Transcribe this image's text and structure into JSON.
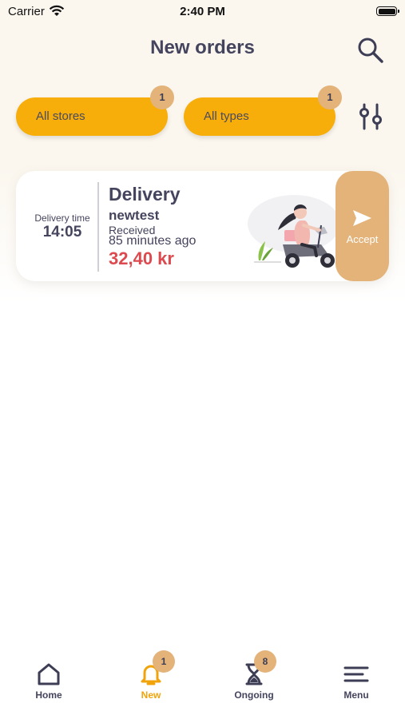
{
  "status_bar": {
    "carrier": "Carrier",
    "time": "2:40 PM"
  },
  "header": {
    "title": "New orders",
    "search_icon": "search-icon",
    "filter_icon": "sliders-icon"
  },
  "filters": [
    {
      "label": "All stores",
      "badge": "1"
    },
    {
      "label": "All types",
      "badge": "1"
    }
  ],
  "order": {
    "time_label": "Delivery time",
    "time": "14:05",
    "type": "Delivery",
    "customer": "newtest",
    "status": "Received",
    "elapsed": "85 minutes ago",
    "price": "32,40 kr",
    "accept_label": "Accept",
    "illustration": "scooter-rider-illustration"
  },
  "tabs": [
    {
      "label": "Home",
      "icon": "home-icon"
    },
    {
      "label": "New",
      "icon": "bell-icon",
      "badge": "1",
      "active": true
    },
    {
      "label": "Ongoing",
      "icon": "hourglass-icon",
      "badge": "8"
    },
    {
      "label": "Menu",
      "icon": "menu-icon"
    }
  ],
  "colors": {
    "accent": "#f7ae0a",
    "badge": "#e3b37a",
    "price": "#dc4a4f",
    "text": "#45445e",
    "active_tab": "#f0a30a"
  }
}
